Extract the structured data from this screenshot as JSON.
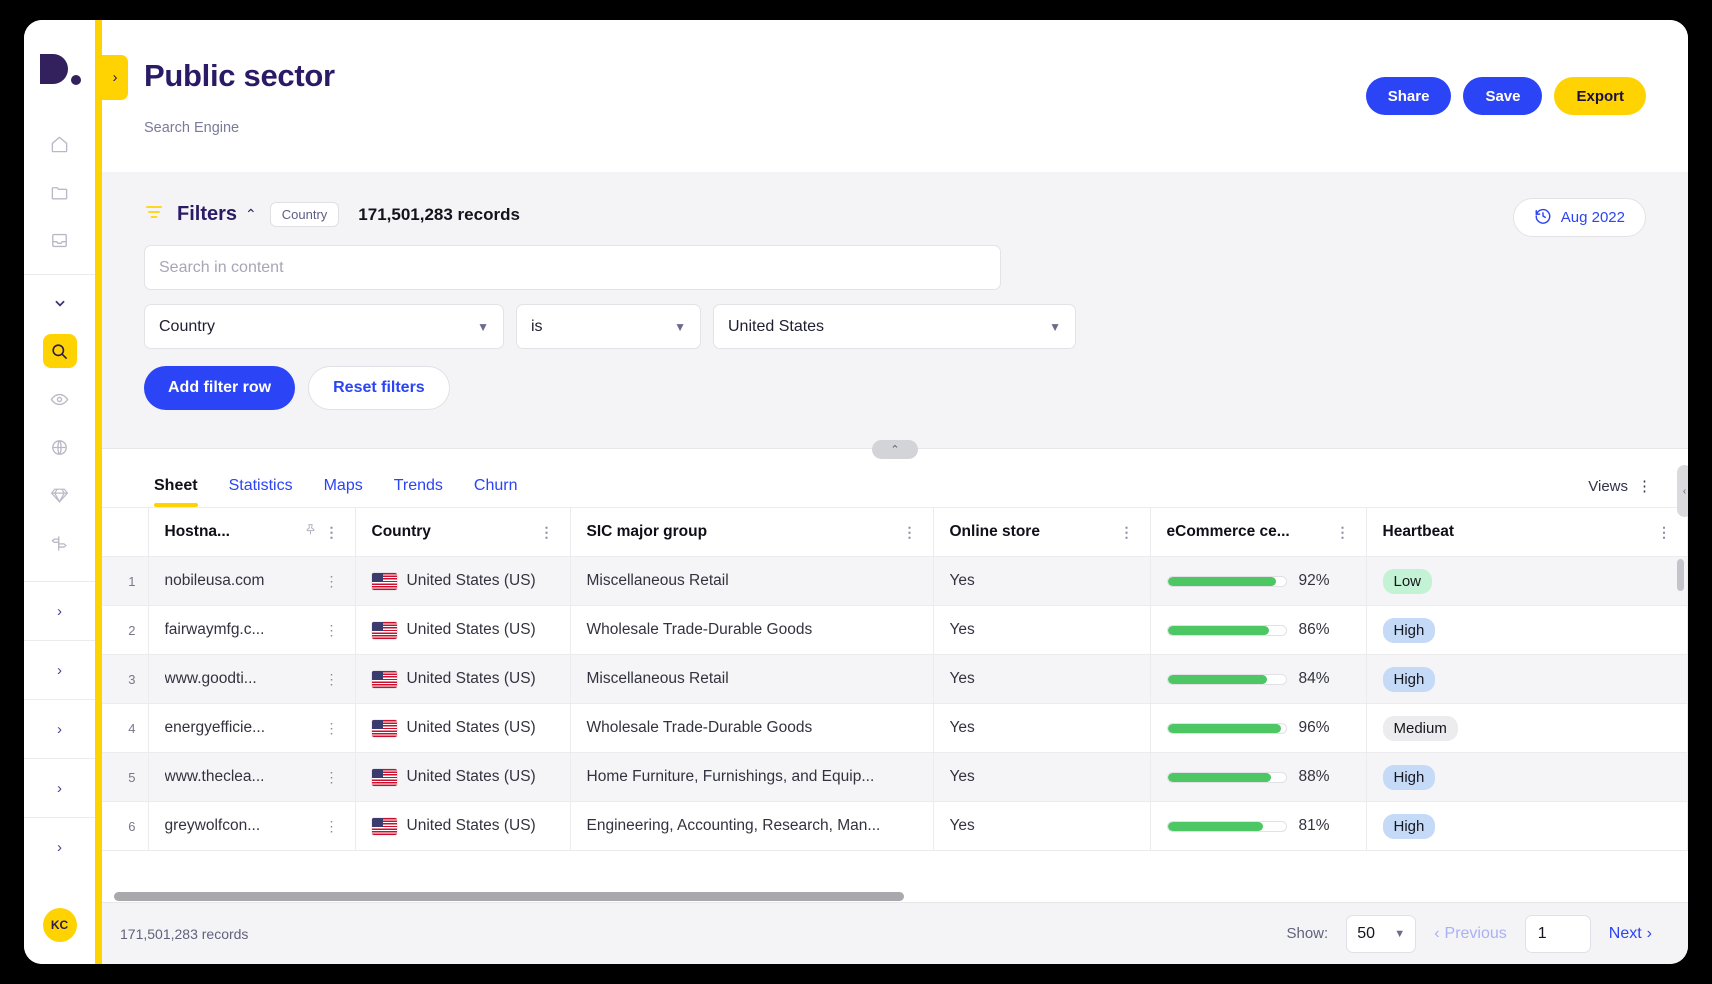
{
  "app": {
    "logo_alt": "dealfront-logo",
    "avatar_initials": "KC"
  },
  "sidebar": {
    "icons": [
      {
        "name": "home-icon",
        "glyph": "home"
      },
      {
        "name": "folder-icon",
        "glyph": "folder"
      },
      {
        "name": "archive-icon",
        "glyph": "archive"
      },
      {
        "name": "chevron-down-icon",
        "glyph": "chevron-down"
      },
      {
        "name": "search-icon",
        "glyph": "search",
        "active": true
      },
      {
        "name": "eye-icon",
        "glyph": "eye"
      },
      {
        "name": "globe-icon",
        "glyph": "globe"
      },
      {
        "name": "diamond-icon",
        "glyph": "diamond"
      },
      {
        "name": "signpost-icon",
        "glyph": "signpost"
      }
    ],
    "expanders": [
      "›",
      "›",
      "›",
      "›",
      "›"
    ]
  },
  "header": {
    "expand_caret": "›",
    "title": "Public sector",
    "subtitle": "Search Engine",
    "buttons": [
      {
        "label": "Share",
        "style": "blue"
      },
      {
        "label": "Save",
        "style": "blue"
      },
      {
        "label": "Export",
        "style": "yellow"
      }
    ]
  },
  "filters": {
    "label": "Filters",
    "caret": "⌃",
    "chip": "Country",
    "record_count": "171,501,283 records",
    "date_pill": "Aug 2022",
    "date_icon": "history-icon",
    "search_placeholder": "Search in content",
    "search_value": "",
    "row": {
      "field": "Country",
      "operator": "is",
      "value": "United States"
    },
    "add_filter_label": "Add filter row",
    "reset_label": "Reset filters",
    "collapse_caret": "⌃"
  },
  "tabs": [
    {
      "label": "Sheet",
      "active": true
    },
    {
      "label": "Statistics",
      "active": false
    },
    {
      "label": "Maps",
      "active": false
    },
    {
      "label": "Trends",
      "active": false
    },
    {
      "label": "Churn",
      "active": false
    }
  ],
  "views": {
    "label": "Views",
    "kebab": "⋮"
  },
  "table": {
    "columns": [
      {
        "key": "idx",
        "label": "",
        "cls": "col-idx",
        "pin": false,
        "kebab": false
      },
      {
        "key": "host",
        "label": "Hostna...",
        "cls": "col-host",
        "pin": true,
        "kebab": true
      },
      {
        "key": "country",
        "label": "Country",
        "cls": "col-country",
        "pin": false,
        "kebab": true
      },
      {
        "key": "sic",
        "label": "SIC major group",
        "cls": "col-sic",
        "pin": false,
        "kebab": true
      },
      {
        "key": "online",
        "label": "Online store",
        "cls": "col-online",
        "pin": false,
        "kebab": true
      },
      {
        "key": "ecom",
        "label": "eCommerce ce...",
        "cls": "col-ecom",
        "pin": false,
        "kebab": true
      },
      {
        "key": "hb",
        "label": "Heartbeat",
        "cls": "col-hb",
        "pin": false,
        "kebab": true
      }
    ],
    "rows": [
      {
        "idx": "1",
        "host": "nobileusa.com",
        "country": "United States (US)",
        "sic": "Miscellaneous Retail",
        "online": "Yes",
        "pct": 92,
        "pct_label": "92%",
        "hb": "Low",
        "hb_style": "low"
      },
      {
        "idx": "2",
        "host": "fairwaymfg.c...",
        "country": "United States (US)",
        "sic": "Wholesale Trade-Durable Goods",
        "online": "Yes",
        "pct": 86,
        "pct_label": "86%",
        "hb": "High",
        "hb_style": "high"
      },
      {
        "idx": "3",
        "host": "www.goodti...",
        "country": "United States (US)",
        "sic": "Miscellaneous Retail",
        "online": "Yes",
        "pct": 84,
        "pct_label": "84%",
        "hb": "High",
        "hb_style": "high"
      },
      {
        "idx": "4",
        "host": "energyefficie...",
        "country": "United States (US)",
        "sic": "Wholesale Trade-Durable Goods",
        "online": "Yes",
        "pct": 96,
        "pct_label": "96%",
        "hb": "Medium",
        "hb_style": "medium"
      },
      {
        "idx": "5",
        "host": "www.theclea...",
        "country": "United States (US)",
        "sic": "Home Furniture, Furnishings, and Equip...",
        "online": "Yes",
        "pct": 88,
        "pct_label": "88%",
        "hb": "High",
        "hb_style": "high"
      },
      {
        "idx": "6",
        "host": "greywolfcon...",
        "country": "United States (US)",
        "sic": "Engineering, Accounting, Research, Man...",
        "online": "Yes",
        "pct": 81,
        "pct_label": "81%",
        "hb": "High",
        "hb_style": "high"
      }
    ]
  },
  "footer": {
    "record_count": "171,501,283 records",
    "show_label": "Show:",
    "page_size": "50",
    "previous_label": "Previous",
    "previous_caret": "‹",
    "page_number": "1",
    "next_label": "Next",
    "next_caret": "›"
  },
  "colors": {
    "brand_purple": "#2b1a66",
    "accent_yellow": "#FFD302",
    "accent_blue": "#2B44F5",
    "bar_green": "#4CC764",
    "badge_low": "#c3f3d4",
    "badge_high": "#c4daf7",
    "badge_medium": "#ececee"
  }
}
